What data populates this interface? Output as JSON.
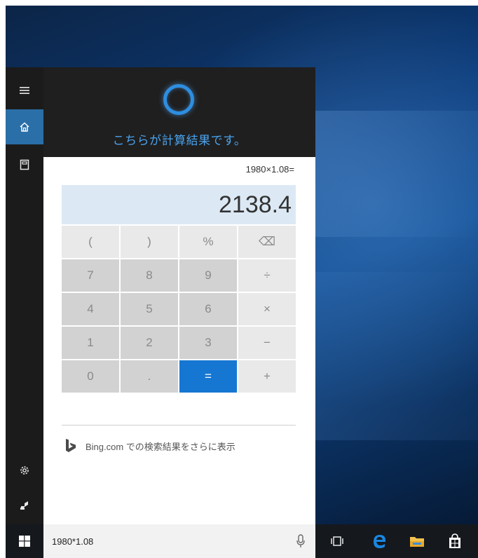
{
  "cortana": {
    "header_message": "こちらが計算結果です。",
    "rail": [
      {
        "icon": "hamburger-menu-icon"
      },
      {
        "icon": "home-icon",
        "active": true
      },
      {
        "icon": "notebook-icon"
      },
      {
        "icon": "settings-gear-icon"
      },
      {
        "icon": "feedback-icon"
      }
    ]
  },
  "calculator": {
    "expression": "1980×1.08=",
    "result": "2138.4",
    "keys": [
      {
        "label": "(",
        "kind": "fn"
      },
      {
        "label": ")",
        "kind": "fn"
      },
      {
        "label": "%",
        "kind": "fn"
      },
      {
        "label": "⌫",
        "kind": "fn",
        "icon": "backspace-icon"
      },
      {
        "label": "7",
        "kind": "num"
      },
      {
        "label": "8",
        "kind": "num"
      },
      {
        "label": "9",
        "kind": "num"
      },
      {
        "label": "÷",
        "kind": "op"
      },
      {
        "label": "4",
        "kind": "num"
      },
      {
        "label": "5",
        "kind": "num"
      },
      {
        "label": "6",
        "kind": "num"
      },
      {
        "label": "×",
        "kind": "op"
      },
      {
        "label": "1",
        "kind": "num"
      },
      {
        "label": "2",
        "kind": "num"
      },
      {
        "label": "3",
        "kind": "num"
      },
      {
        "label": "−",
        "kind": "op"
      },
      {
        "label": "0",
        "kind": "num"
      },
      {
        "label": ".",
        "kind": "num"
      },
      {
        "label": "=",
        "kind": "eq"
      },
      {
        "label": "+",
        "kind": "op"
      }
    ]
  },
  "bing": {
    "link_text": "Bing.com での検索結果をさらに表示"
  },
  "taskbar": {
    "search_value": "1980*1.08",
    "icons": [
      "task-view-icon",
      "edge-browser-icon",
      "file-explorer-icon",
      "store-icon"
    ]
  },
  "colors": {
    "accent_blue": "#1677d2",
    "cortana_ring": "#2e8ee0",
    "rail_active": "#2a6fa8",
    "result_bg": "#dce9f5"
  }
}
